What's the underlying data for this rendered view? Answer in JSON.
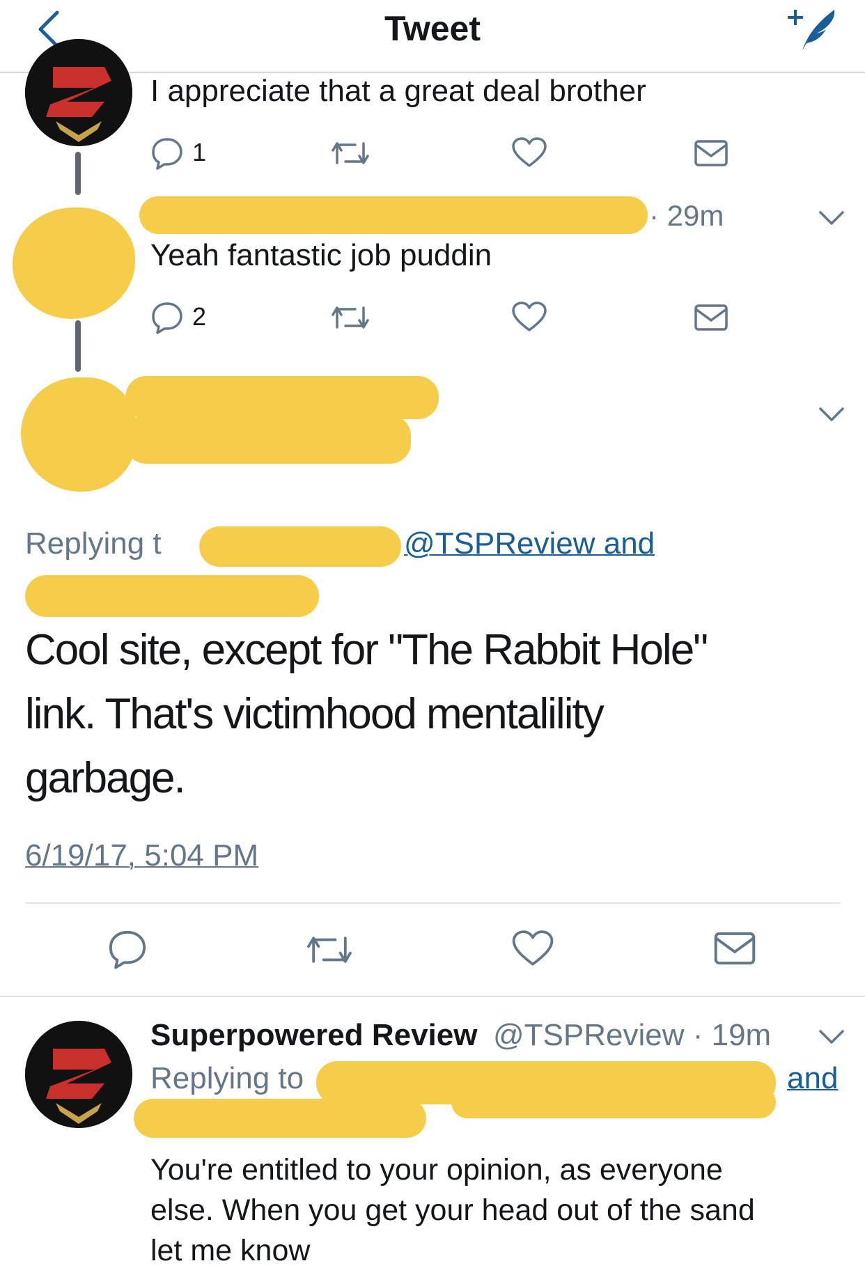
{
  "nav": {
    "title": "Tweet",
    "back_icon": "chevron-left-icon",
    "compose_icon": "compose-quill-icon"
  },
  "reply1": {
    "text": "I appreciate that a great deal brother",
    "reply_count": "1"
  },
  "reply2": {
    "time": "· 29m",
    "text": "Yeah fantastic job puddin",
    "reply_count": "2"
  },
  "main_tweet": {
    "replying_prefix": "Replying t",
    "replying_mention": "@TSPReview and",
    "text_line1": "Cool site, except for \"The Rabbit Hole\"",
    "text_line2": "link. That's victimhood mentalility",
    "text_line3": "garbage.",
    "timestamp": "6/19/17, 5:04 PM"
  },
  "reply3": {
    "name": "Superpowered Review",
    "handle_time": "@TSPReview · 19m",
    "replying_prefix": "Replying to",
    "replying_suffix": "and",
    "text_line1": "You're entitled to your opinion, as everyone",
    "text_line2": "else. When you get your head out of the sand",
    "text_line3": "let me know"
  },
  "colors": {
    "accent": "#1b5e96",
    "redaction": "#f6cd4a",
    "text": "#14171a",
    "muted": "#657786"
  }
}
